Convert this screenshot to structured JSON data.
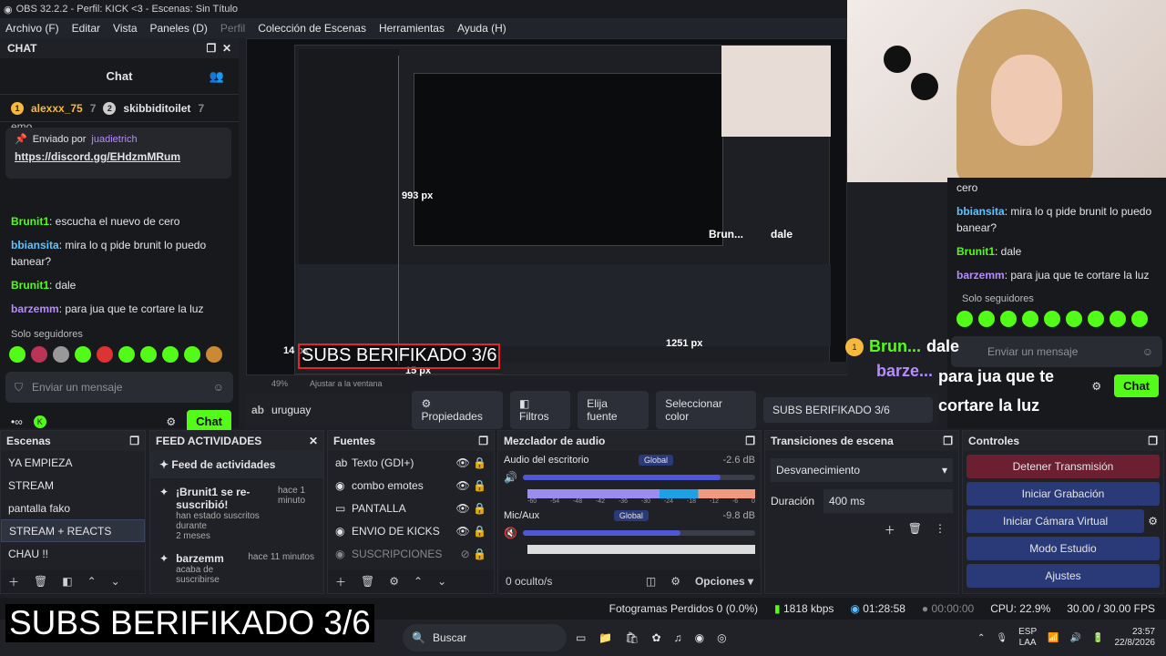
{
  "window": {
    "title": "OBS 32.2.2 - Perfil: KICK <3 - Escenas: Sin Título"
  },
  "menu": [
    "Archivo (F)",
    "Editar",
    "Vista",
    "Paneles (D)",
    "Perfil",
    "Colección de Escenas",
    "Herramientas",
    "Ayuda (H)"
  ],
  "chat": {
    "dock_title": "CHAT",
    "title": "Chat",
    "gifters": [
      {
        "name": "alexxx_75",
        "count": "7"
      },
      {
        "name": "skibbiditoilet",
        "count": "7"
      }
    ],
    "cut_text": "emo",
    "pinned": {
      "label": "Enviado por",
      "user": "juadietrich",
      "link": "https://discord.gg/EHdzmMRum"
    },
    "messages": [
      {
        "user": "Brunit1",
        "text": ": escucha el nuevo de cero"
      },
      {
        "user": "bbiansita",
        "text": ": mira lo q pide brunit lo puedo banear?"
      },
      {
        "user": "Brunit1",
        "text": ": dale"
      },
      {
        "user": "barzemm",
        "text": ": para jua que te cortare la luz"
      }
    ],
    "followers_only": "Solo seguidores",
    "input_placeholder": "Enviar un mensaje",
    "send_label": "Chat"
  },
  "right_chat": {
    "top_text": "cero",
    "messages": [
      {
        "user": "bbiansita",
        "text": ": mira lo q pide brunit lo puedo banear?"
      },
      {
        "user": "Brunit1",
        "text": ": dale"
      },
      {
        "user": "barzemm",
        "text": ": para jua que te cortare la luz"
      }
    ],
    "followers_only": "Solo seguidores",
    "input_placeholder": "Enviar un mensaje",
    "send_label": "Chat"
  },
  "preview": {
    "overlay_text": "SUBS BERIFIKADO 3/6",
    "dim_993": "993 px",
    "dim_1251": "1251 px",
    "dim_14": "14 px",
    "dim_15": "15 px",
    "floating_user1": "Brun...",
    "floating_msg1": "dale",
    "floating_user2": "barze...",
    "floating_msg2": "para jua que te cortare la luz",
    "zoom": "49%",
    "fit": "Ajustar a la ventana"
  },
  "source_bar": {
    "source": "uruguay",
    "props": "Propiedades",
    "filters": "Filtros",
    "choose": "Elija fuente",
    "color": "Seleccionar color",
    "current": "SUBS BERIFIKADO 3/6"
  },
  "scenes": {
    "title": "Escenas",
    "items": [
      "YA EMPIEZA",
      "STREAM",
      "pantalla fako",
      "STREAM + REACTS",
      "CHAU !!"
    ],
    "selected": 3
  },
  "feed": {
    "title": "FEED ACTIVIDADES",
    "header": "Feed de actividades",
    "items": [
      {
        "title": "¡Brunit1 se re-suscribió!",
        "sub": "han estado suscritos durante",
        "dur": "2 meses",
        "time": "hace 1 minuto"
      },
      {
        "title": "barzemm",
        "sub": "acaba de suscribirse",
        "dur": "",
        "time": "hace 11 minutos"
      }
    ]
  },
  "sources": {
    "title": "Fuentes",
    "items": [
      "Texto (GDI+)",
      "combo emotes",
      "PANTALLA",
      "ENVIO DE KICKS",
      "SUSCRIPCIONES"
    ]
  },
  "mixer": {
    "title": "Mezclador de audio",
    "channels": [
      {
        "name": "Audio del escritorio",
        "tag": "Global",
        "db": "-2.6 dB",
        "level": 0.85
      },
      {
        "name": "Mic/Aux",
        "tag": "Global",
        "db": "-9.8 dB",
        "level": 0.68
      }
    ],
    "scale": [
      "-60",
      "-54",
      "-48",
      "-42",
      "-36",
      "-30",
      "-24",
      "-18",
      "-12",
      "-6",
      "0"
    ],
    "hidden": "0 oculto/s",
    "options": "Opciones"
  },
  "transitions": {
    "title": "Transiciones de escena",
    "type": "Desvanecimiento",
    "duration_label": "Duración",
    "duration": "400 ms"
  },
  "controls": {
    "title": "Controles",
    "buttons": [
      "Detener Transmisión",
      "Iniciar Grabación",
      "Iniciar Cámara Virtual",
      "Modo Estudio",
      "Ajustes"
    ]
  },
  "status": {
    "dropped": "Fotogramas Perdidos 0 (0.0%)",
    "kbps": "1818 kbps",
    "live": "01:28:58",
    "rec": "00:00:00",
    "cpu": "CPU: 22.9%",
    "fps": "30.00 / 30.00 FPS"
  },
  "taskbar": {
    "search": "Buscar",
    "lang": "ESP",
    "lang2": "LAA",
    "time": "23:57",
    "date": "22/8/2026"
  },
  "overlay": {
    "text": "SUBS BERIFIKADO 3/6"
  }
}
